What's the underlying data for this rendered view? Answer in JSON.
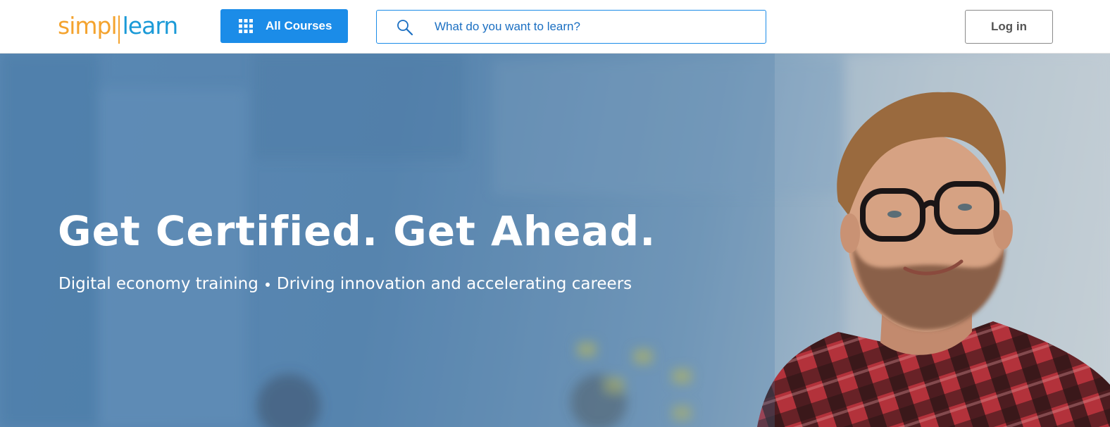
{
  "header": {
    "logo": {
      "part1": "simpl",
      "part2": "learn"
    },
    "all_courses_label": "All Courses",
    "search": {
      "placeholder": "What do you want to learn?"
    },
    "login_label": "Log in"
  },
  "hero": {
    "title": "Get Certified. Get Ahead.",
    "subtitle_part1": "Digital economy training",
    "subtitle_part2": "Driving innovation and accelerating careers"
  },
  "icons": [
    "grid-icon",
    "search-icon"
  ],
  "colors": {
    "brand_orange": "#f4a32e",
    "brand_blue": "#1b9ad7",
    "button_blue": "#1b8ce8",
    "hero_blue": "#5a87b1"
  }
}
